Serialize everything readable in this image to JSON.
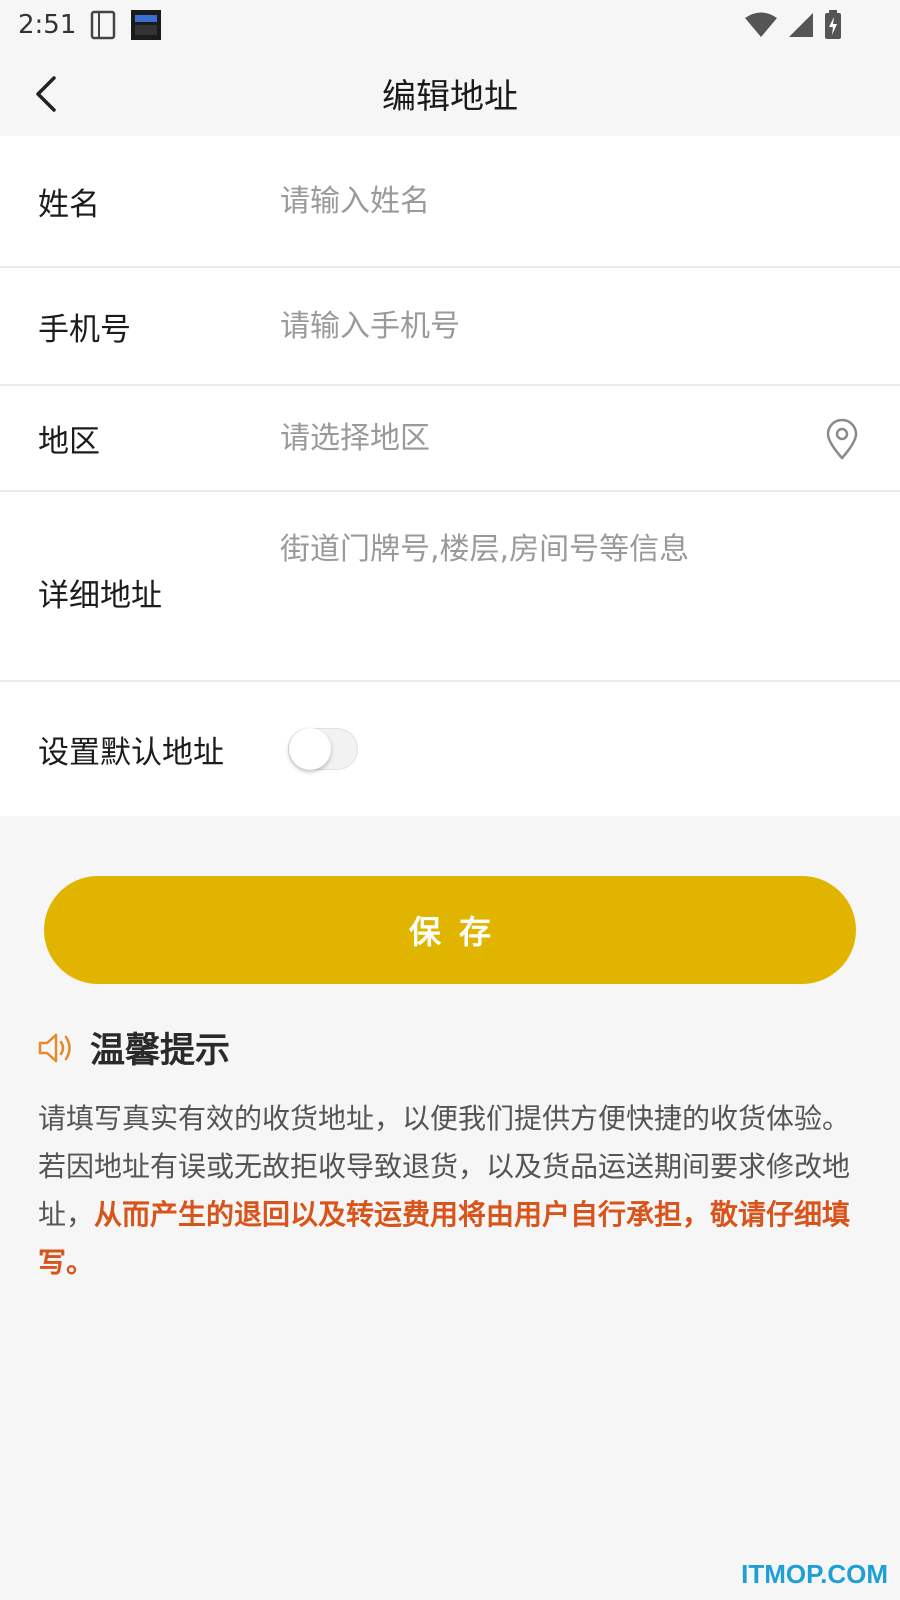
{
  "status_bar": {
    "time": "2:51"
  },
  "nav": {
    "title": "编辑地址"
  },
  "form": {
    "name": {
      "label": "姓名",
      "placeholder": "请输入姓名"
    },
    "phone": {
      "label": "手机号",
      "placeholder": "请输入手机号"
    },
    "region": {
      "label": "地区",
      "placeholder": "请选择地区"
    },
    "detail": {
      "label": "详细地址",
      "placeholder": "街道门牌号,楼层,房间号等信息"
    },
    "default_address": {
      "label": "设置默认地址",
      "enabled": false
    }
  },
  "save_button": {
    "label": "保存"
  },
  "tip": {
    "title": "温馨提示",
    "text": "请填写真实有效的收货地址，以便我们提供方便快捷的收货体验。若因地址有误或无故拒收导致退货，以及货品运送期间要求修改地址，",
    "highlight": "从而产生的退回以及转运费用将由用户自行承担，敬请仔细填写。"
  },
  "watermark": "ITMOP.COM",
  "icons": {
    "back": "chevron-left-icon",
    "location": "location-pin-icon",
    "speaker": "speaker-icon"
  },
  "colors": {
    "accent": "#e1b400",
    "warning_text": "#d9541a",
    "speaker_icon": "#e48a2c",
    "watermark": "#1ea0d6"
  }
}
